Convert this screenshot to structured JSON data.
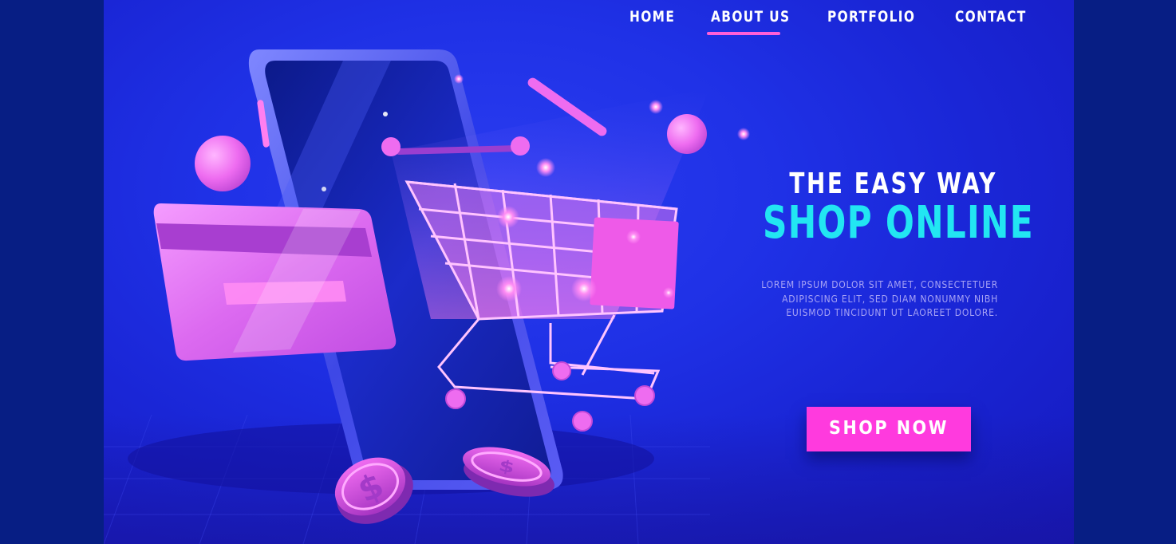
{
  "nav": {
    "items": [
      {
        "label": "HOME"
      },
      {
        "label": "ABOUT US",
        "active": true
      },
      {
        "label": "PORTFOLIO"
      },
      {
        "label": "CONTACT"
      }
    ]
  },
  "hero": {
    "line1": "THE EASY WAY",
    "line2": "SHOP ONLINE",
    "body_lines": [
      "LOREM IPSUM DOLOR SIT AMET, CONSECTETUER",
      "ADIPISCING ELIT, SED DIAM NONUMMY NIBH",
      "EUISMOD TINCIDUNT UT LAOREET DOLORE."
    ],
    "cta_label": "SHOP NOW"
  },
  "illustration": {
    "coin_symbol": "$",
    "icons": [
      "smartphone-icon",
      "shopping-cart-icon",
      "credit-card-icon",
      "dollar-coin-icon"
    ]
  },
  "colors": {
    "background": "#1f31e6",
    "side_panel": "#071e84",
    "accent_pink": "#ff3ade",
    "headline_cyan": "#22e6f2",
    "nav_active_underline": "#ff5fd8"
  }
}
